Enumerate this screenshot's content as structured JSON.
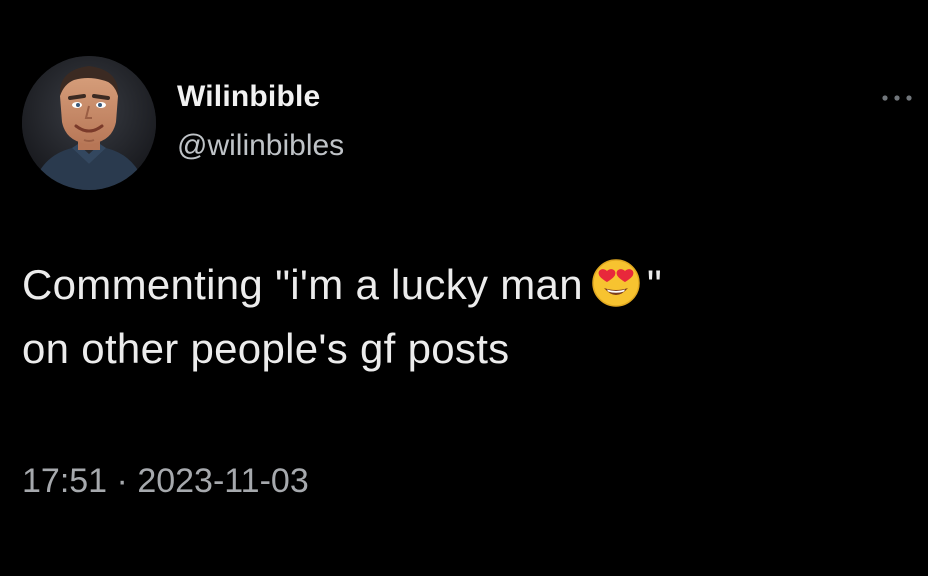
{
  "author": {
    "display_name": "Wilinbible",
    "handle": "@wilinbibles"
  },
  "tweet": {
    "text_before_emoji": "Commenting \"i'm a lucky man",
    "emoji": "smiling-face-with-heart-eyes",
    "text_after_emoji": "\"",
    "line_2": "on other people's gf posts",
    "time": "17:51",
    "separator": "·",
    "date": "2023-11-03"
  },
  "icons": {
    "more": "more-options-icon",
    "avatar": "avatar-image"
  },
  "colors": {
    "background": "#000000",
    "primary_text": "#e7e9ea",
    "secondary_text": "#a6a9ad",
    "emoji_face": "#f7c330",
    "emoji_hearts": "#e8283b"
  }
}
